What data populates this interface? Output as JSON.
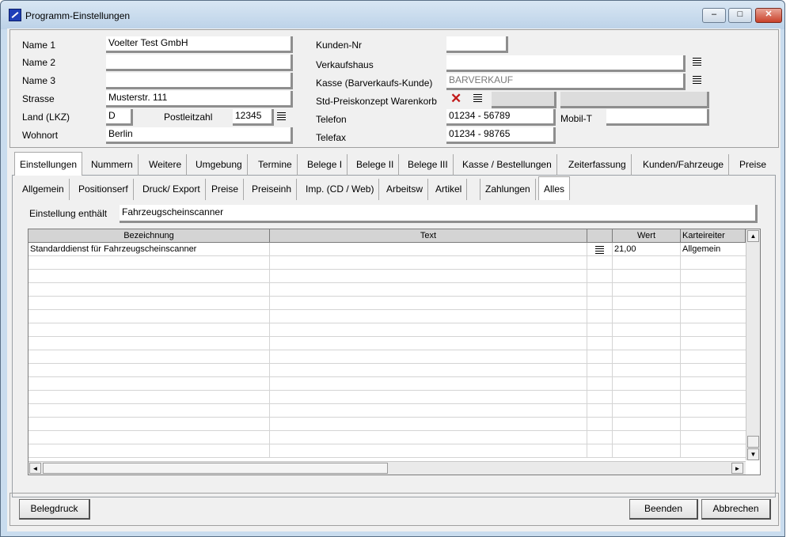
{
  "window": {
    "title": "Programm-Einstellungen",
    "min": "‒",
    "max": "□",
    "close": "✕"
  },
  "header": {
    "name1_label": "Name 1",
    "name1": "Voelter Test GmbH",
    "name2_label": "Name 2",
    "name2": "",
    "name3_label": "Name 3",
    "name3": "",
    "strasse_label": "Strasse",
    "strasse": "Musterstr. 111",
    "land_label": "Land (LKZ)",
    "land": "D",
    "plz_label": "Postleitzahl",
    "plz": "12345",
    "wohnort_label": "Wohnort",
    "wohnort": "Berlin",
    "kundennr_label": "Kunden-Nr",
    "kundennr": "",
    "verkaufshaus_label": "Verkaufshaus",
    "verkaufshaus": "",
    "kasse_label": "Kasse (Barverkaufs-Kunde)",
    "kasse": "BARVERKAUF",
    "preiskonzept_label": "Std-Preiskonzept Warenkorb",
    "telefon_label": "Telefon",
    "telefon": "01234 - 56789",
    "mobil_label": "Mobil-T",
    "mobil": "",
    "telefax_label": "Telefax",
    "telefax": "01234 - 98765"
  },
  "main_tabs": [
    "Einstellungen",
    "Nummern",
    "Weitere",
    "Umgebung",
    "Termine",
    "Belege I",
    "Belege II",
    "Belege III",
    "Kasse / Bestellungen",
    "Zeiterfassung",
    "Kunden/Fahrzeuge",
    "Preise"
  ],
  "main_tab_active": "Einstellungen",
  "sub_tabs": [
    "Allgemein",
    "Positionserf",
    "Druck/ Export",
    "Preise",
    "Preiseinh",
    "Imp. (CD / Web)",
    "Arbeitsw",
    "Artikel",
    "",
    "Zahlungen",
    "Alles"
  ],
  "sub_tab_active": "Alles",
  "filter": {
    "label": "Einstellung enthält",
    "value": "Fahrzeugscheinscanner"
  },
  "grid": {
    "columns": [
      "Bezeichnung",
      "Text",
      "",
      "Wert",
      "Karteireiter"
    ],
    "rows": [
      {
        "bezeichnung": "Standarddienst für Fahrzeugscheinscanner",
        "text": "",
        "wert": "21,00",
        "karteireiter": "Allgemein"
      }
    ]
  },
  "buttons": {
    "belegdruck": "Belegdruck",
    "beenden": "Beenden",
    "abbrechen": "Abbrechen"
  },
  "icons": {
    "list": "list-icon",
    "clear": "delete-x-icon",
    "scroll_up": "▲",
    "scroll_down": "▼",
    "scroll_left": "◄",
    "scroll_right": "►"
  }
}
